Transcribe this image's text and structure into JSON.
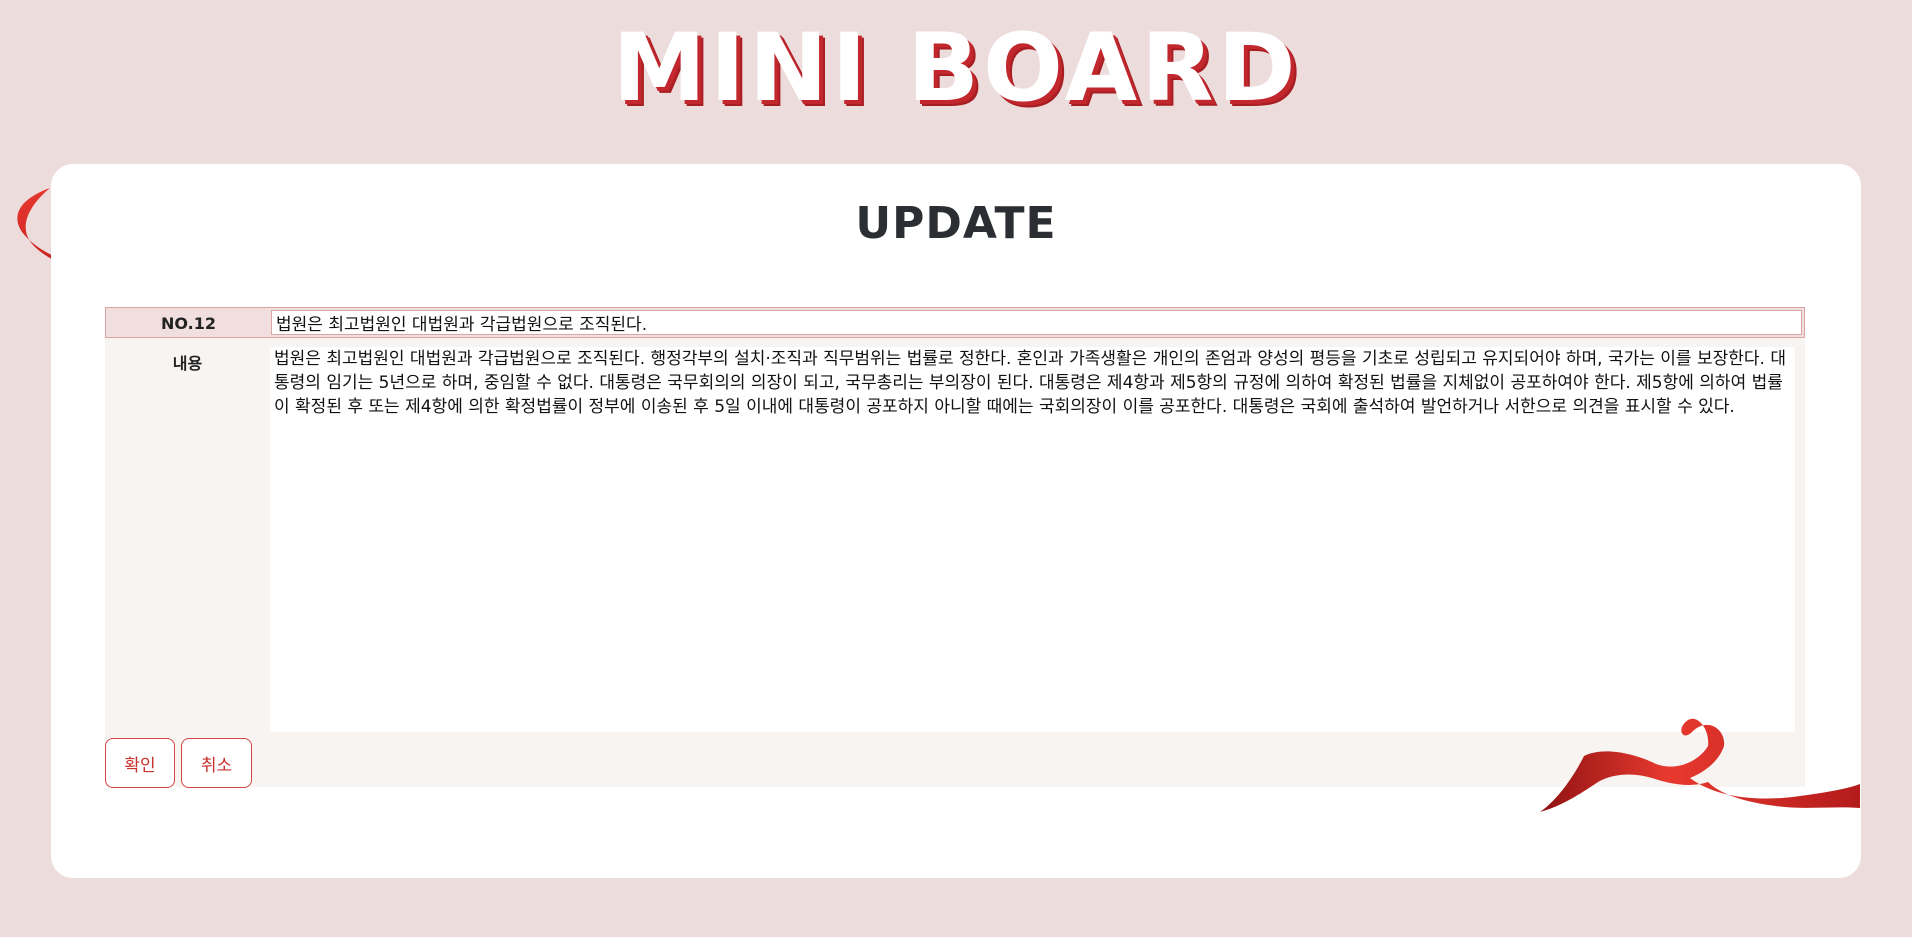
{
  "header": {
    "logo_text": "MINI BOARD"
  },
  "page": {
    "title": "UPDATE"
  },
  "form": {
    "number_label": "NO.12",
    "title_value": "법원은 최고법원인 대법원과 각급법원으로 조직된다.",
    "content_label": "내용",
    "content_value": "법원은 최고법원인 대법원과 각급법원으로 조직된다. 행정각부의 설치·조직과 직무범위는 법률로 정한다. 혼인과 가족생활은 개인의 존엄과 양성의 평등을 기초로 성립되고 유지되어야 하며, 국가는 이를 보장한다. 대통령의 임기는 5년으로 하며, 중임할 수 없다. 대통령은 국무회의의 의장이 되고, 국무총리는 부의장이 된다. 대통령은 제4항과 제5항의 규정에 의하여 확정된 법률을 지체없이 공포하여야 한다. 제5항에 의하여 법률이 확정된 후 또는 제4항에 의한 확정법률이 정부에 이송된 후 5일 이내에 대통령이 공포하지 아니할 때에는 국회의장이 이를 공포한다. 대통령은 국회에 출석하여 발언하거나 서한으로 의견을 표시할 수 있다."
  },
  "buttons": {
    "confirm_label": "확인",
    "cancel_label": "취소"
  },
  "colors": {
    "background": "#eddcdc",
    "accent": "#c1272d",
    "card": "#ffffff",
    "title_row": "#f1dfdf",
    "content_row": "#f7f4f2"
  },
  "icons": {
    "ribbon_left": "red-ribbon-icon",
    "ribbon_right": "red-ribbon-icon"
  }
}
